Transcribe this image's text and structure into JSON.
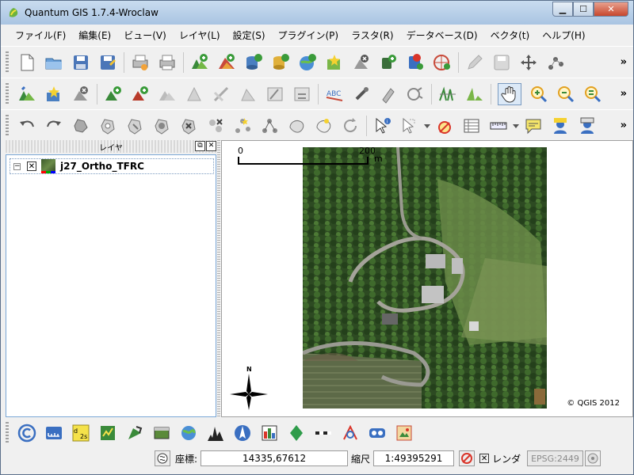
{
  "window": {
    "title": "Quantum GIS 1.7.4-Wroclaw"
  },
  "menu": [
    "ファイル(F)",
    "編集(E)",
    "ビュー(V)",
    "レイヤ(L)",
    "設定(S)",
    "プラグイン(P)",
    "ラスタ(R)",
    "データベース(D)",
    "ベクタ(t)",
    "ヘルプ(H)"
  ],
  "toolbar_more": "»",
  "layers_panel": {
    "title": "レイヤ",
    "float_label": "⧉",
    "close_label": "✕",
    "layers": [
      {
        "name": "j27_Ortho_TFRC",
        "checked_mark": "✕",
        "expander": "−"
      }
    ]
  },
  "map": {
    "scale_zero": "0",
    "scale_max": "200",
    "scale_unit": "m",
    "north_label": "N",
    "copyright": "© QGIS 2012"
  },
  "statusbar": {
    "coord_label": "座標:",
    "coord_value": "14335,67612",
    "scale_label": "縮尺",
    "scale_value": "1:49395291",
    "render_label": "レンダ",
    "render_mark": "✕",
    "epsg": "EPSG:2449"
  },
  "colors": {
    "titlebar": "#b9d1ea",
    "accent": "#3a8a3a"
  }
}
